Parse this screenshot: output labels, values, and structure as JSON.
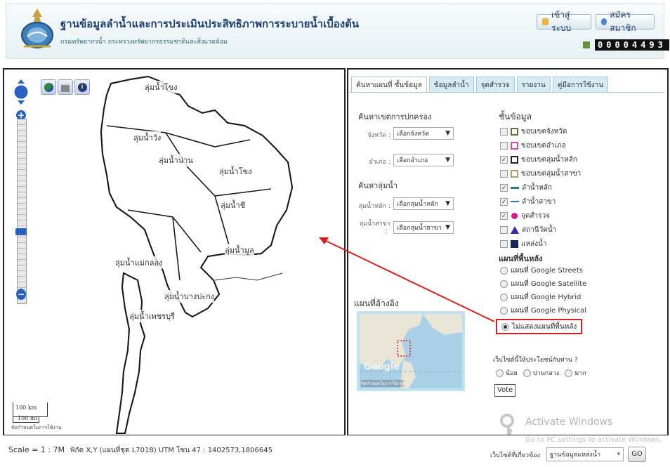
{
  "header": {
    "title": "ฐานข้อมูลลำน้ำและการประเมินประสิทธิภาพการระบายน้ำเบื้องต้น",
    "subtitle": "กรมทรัพยากรน้ำ กระทรวงทรัพยากรธรรมชาติและสิ่งแวดล้อม",
    "login_label": "เข้าสู่ระบบ",
    "register_label": "สมัครสมาชิก",
    "counter": "00004493"
  },
  "map": {
    "basin_labels": [
      "ลุ่มน้ำโขง",
      "ลุ่มน้ำวัง",
      "ลุ่มน้ำน่าน",
      "ลุ่มน้ำโขง",
      "ลุ่มน้ำชี",
      "ลุ่มน้ำมูล",
      "ลุ่มน้ำแม่กลอง",
      "ลุ่มน้ำบางปะกง",
      "ลุ่มน้ำเพชรบุรี"
    ],
    "scale_km": "100 km",
    "scale_mi": "100 mi",
    "terms": "ข้อกำหนดในการใช้งาน"
  },
  "tabs": [
    "ค้นหาแผนที่ ชั้นข้อมูล",
    "ข้อมูลลำน้ำ",
    "จุดสำรวจ",
    "รายงาน",
    "คู่มือการใช้งาน"
  ],
  "search": {
    "admin_heading": "ค้นหาเขตการปกครอง",
    "province_label": "จังหวัด :",
    "province_value": "เลือกจังหวัด",
    "district_label": "อำเภอ :",
    "district_value": "เลือกอำเภอ",
    "basin_heading": "ค้นหาลุ่มน้ำ",
    "main_basin_label": "ลุ่มน้ำหลัก :",
    "main_basin_value": "เลือกลุ่มน้ำหลัก",
    "sub_basin_label": "ลุ่มน้ำสาขา",
    "sub_basin_colon": ":",
    "sub_basin_value": "เลือกลุ่มน้ำสาขา"
  },
  "layers": {
    "heading": "ชั้นข้อมูล",
    "items": [
      {
        "label": "ขอบเขตจังหวัด",
        "checked": false,
        "color": "#6b6b3a"
      },
      {
        "label": "ขอบเขตอำเภอ",
        "checked": false,
        "color": "#d04fb0"
      },
      {
        "label": "ขอบเขตลุ่มน้ำหลัก",
        "checked": true,
        "color": "#222222"
      },
      {
        "label": "ขอบเขตลุ่มน้ำสาขา",
        "checked": false,
        "color": "#b59a6a"
      },
      {
        "label": "ลำน้ำหลัก",
        "checked": true,
        "color": "#2a7d8e"
      },
      {
        "label": "ลำน้ำสาขา",
        "checked": true,
        "color": "#2f6fd0"
      },
      {
        "label": "จุดสำรวจ",
        "checked": true,
        "color": "#e0148c"
      },
      {
        "label": "สถานีวัดน้ำ",
        "checked": false,
        "color": "#3b2aa8"
      },
      {
        "label": "แหล่งน้ำ",
        "checked": false,
        "color": "#14265f"
      }
    ]
  },
  "basemap": {
    "heading": "แผนที่พื้นหลัง",
    "options": [
      "แผนที่ Google Streets",
      "แผนที่ Google Satellite",
      "แผนที่ Google Hybrid",
      "แผนที่ Google Physical",
      "ไม่แสดงแผนที่พื้นหลัง"
    ],
    "selected": 4
  },
  "reference": {
    "heading": "แผนที่อ้างอิง",
    "google": "Google",
    "terms": "ข้อกำหนดในการใช้งาน"
  },
  "poll": {
    "question": "เว็บไซต์นี้ให้ประโยชน์กับท่าน ?",
    "options": [
      "น้อย",
      "ปานกลาง",
      "มาก"
    ],
    "vote_label": "Vote"
  },
  "watermark": {
    "line1": "Activate Windows",
    "line2": "Go to PC settings to activate Windows."
  },
  "status": {
    "scale": "Scale = 1 : 7M",
    "coords": "พิกัด X,Y (แผนที่ชุด L7018) UTM โซน 47 : 1402573,1806645",
    "related_label": "เว็บไซต์ที่เกี่ยวข้อง",
    "related_value": "ฐานข้อมูลแหล่งน้ำ",
    "go_label": "GO"
  },
  "colors": {
    "accent": "#d62020",
    "header": "#1d3f6e",
    "river": "#2f6fd0",
    "point": "#e0148c"
  }
}
